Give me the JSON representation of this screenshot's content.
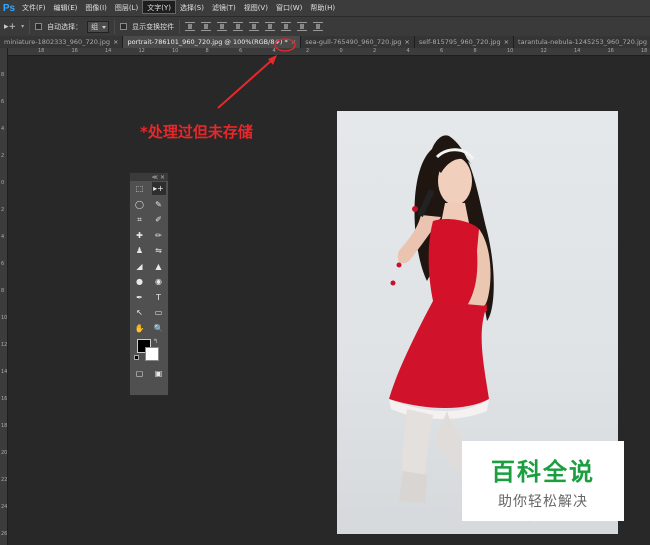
{
  "app": {
    "logo": "Ps"
  },
  "menu": [
    "文件(F)",
    "编辑(E)",
    "图像(I)",
    "图层(L)",
    "文字(Y)",
    "选择(S)",
    "滤镜(T)",
    "视图(V)",
    "窗口(W)",
    "帮助(H)"
  ],
  "menu_active_index": 4,
  "options": {
    "tool_glyph": "▸+",
    "auto_select_label": "自动选择：",
    "auto_select_value": "组",
    "transform_label": "显示变换控件"
  },
  "tabs": [
    {
      "label": "miniature-1802333_960_720.jpg",
      "active": false
    },
    {
      "label": "portrait-786101_960_720.jpg @ 100%(RGB/8#) *",
      "active": true
    },
    {
      "label": "sea-gull-765490_960_720.jpg",
      "active": false
    },
    {
      "label": "self-815795_960_720.jpg",
      "active": false
    },
    {
      "label": "tarantula-nebula-1245253_960_720.jpg",
      "active": false
    }
  ],
  "tab_close_glyph": "×",
  "ruler": {
    "h_labels": [
      "18",
      "16",
      "14",
      "12",
      "10",
      "8",
      "6",
      "4",
      "2",
      "0",
      "2",
      "4",
      "6",
      "8",
      "10",
      "12",
      "14",
      "16",
      "18"
    ],
    "v_labels": [
      "8",
      "6",
      "4",
      "2",
      "0",
      "2",
      "4",
      "6",
      "8",
      "10",
      "12",
      "14",
      "16",
      "18",
      "20",
      "22",
      "24",
      "26"
    ]
  },
  "toolbox": {
    "header_glyphs": "≪ ×",
    "rows": [
      [
        "⬚",
        "▸+"
      ],
      [
        "◯",
        "✎"
      ],
      [
        "⌗",
        "✐"
      ],
      [
        "✚",
        "✏"
      ],
      [
        "♟",
        "⇋"
      ],
      [
        "◢",
        "▲"
      ],
      [
        "●",
        "◉"
      ],
      [
        "✒",
        "T"
      ],
      [
        "↖",
        "▭"
      ],
      [
        "✋",
        "🔍"
      ]
    ],
    "bottom_rows": [
      [
        "▢",
        "▣"
      ]
    ],
    "swap_glyph": "↰"
  },
  "annotation": {
    "text": "*处理过但未存储",
    "color": "#e8272b"
  },
  "watermark": {
    "title": "百科全说",
    "subtitle": "助你轻松解决"
  }
}
